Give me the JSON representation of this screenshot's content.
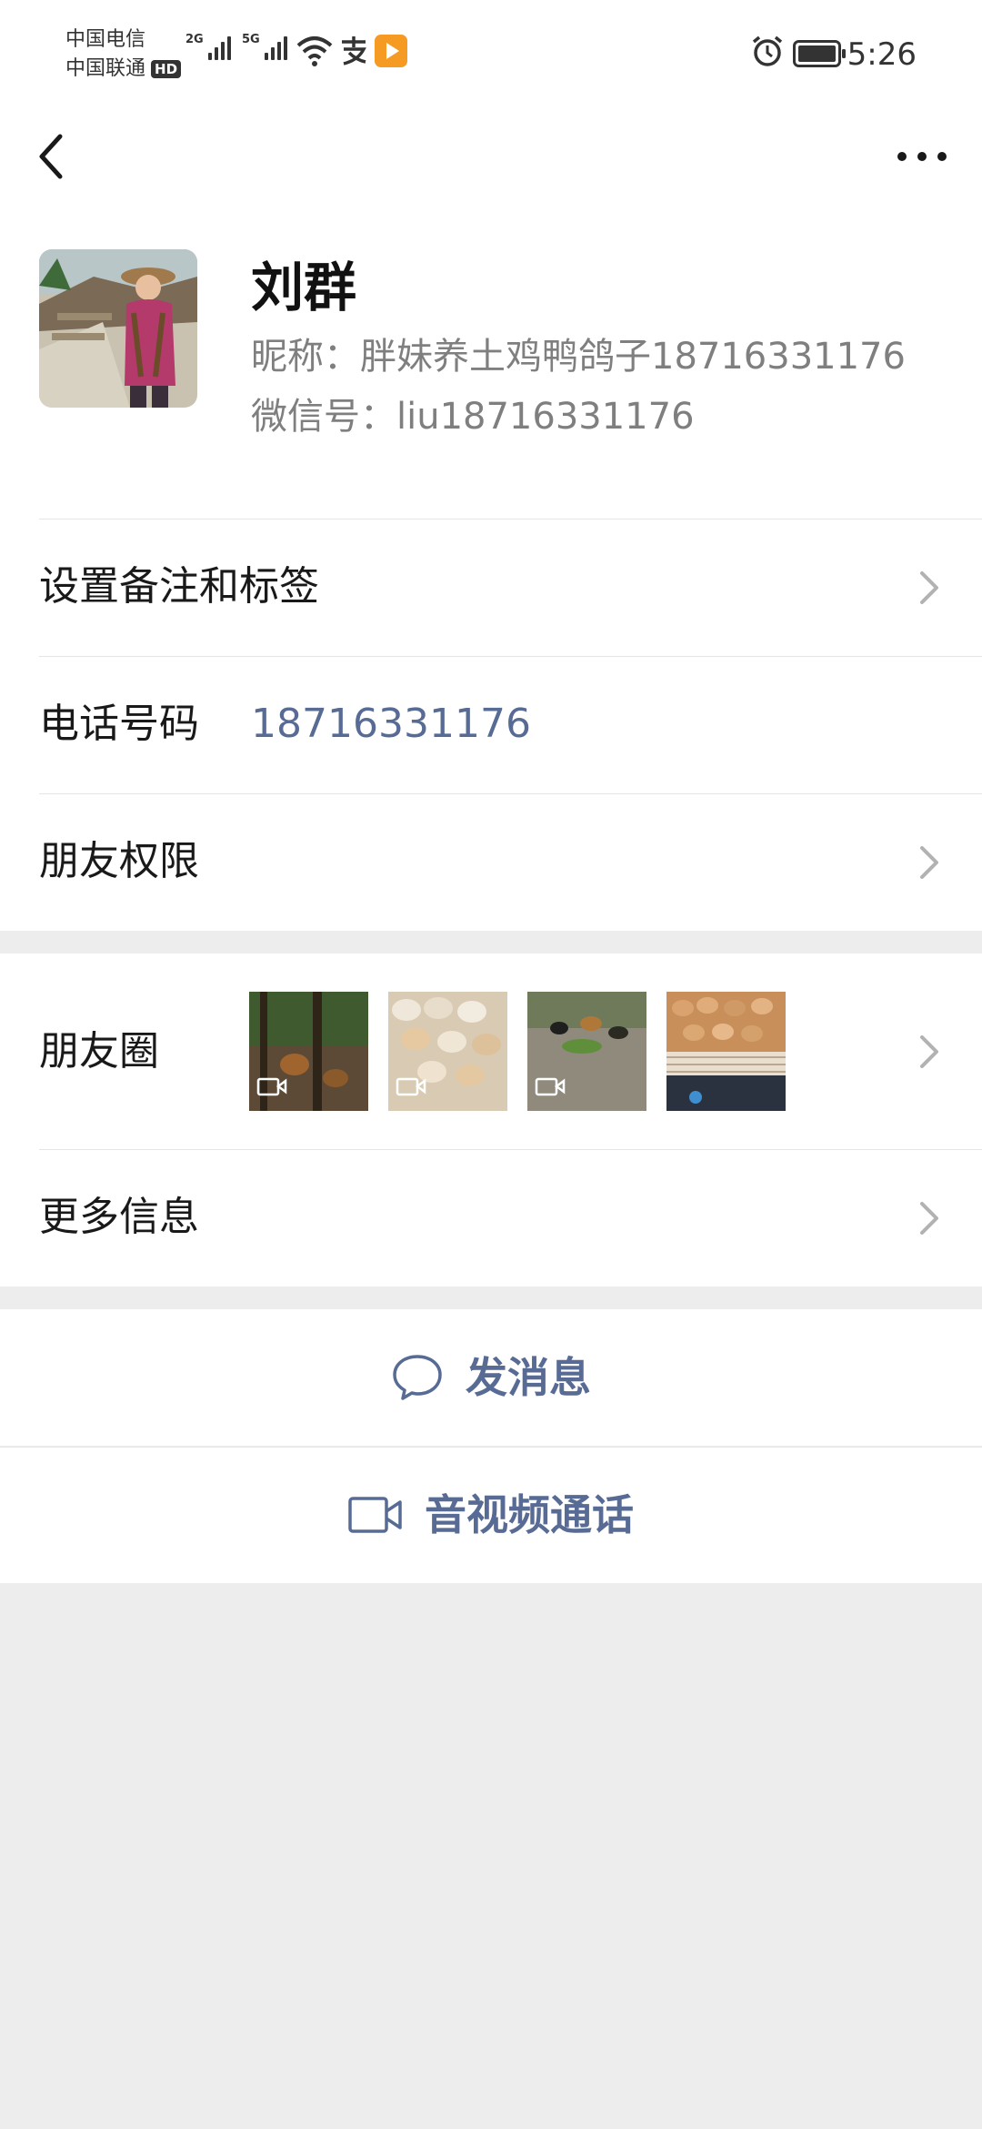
{
  "status_bar": {
    "carrier_1": "中国电信",
    "carrier_2": "中国联通",
    "hd_badge": "HD",
    "signal_1_tag": "2G",
    "signal_2_tag": "5G",
    "time": "5:26"
  },
  "profile": {
    "name": "刘群",
    "nickname_line": "昵称：胖妹养土鸡鸭鸽子18716331176",
    "wechat_id_line": "微信号：liu18716331176"
  },
  "cells": {
    "remark_tags": "设置备注和标签",
    "phone_label": "电话号码",
    "phone_value": "18716331176",
    "friend_permissions": "朋友权限",
    "moments": "朋友圈",
    "more_info": "更多信息"
  },
  "actions": {
    "send_message": "发消息",
    "video_call": "音视频通话"
  },
  "colors": {
    "link_blue": "#576b95",
    "background": "#ededed",
    "divider": "#e5e5e5"
  }
}
